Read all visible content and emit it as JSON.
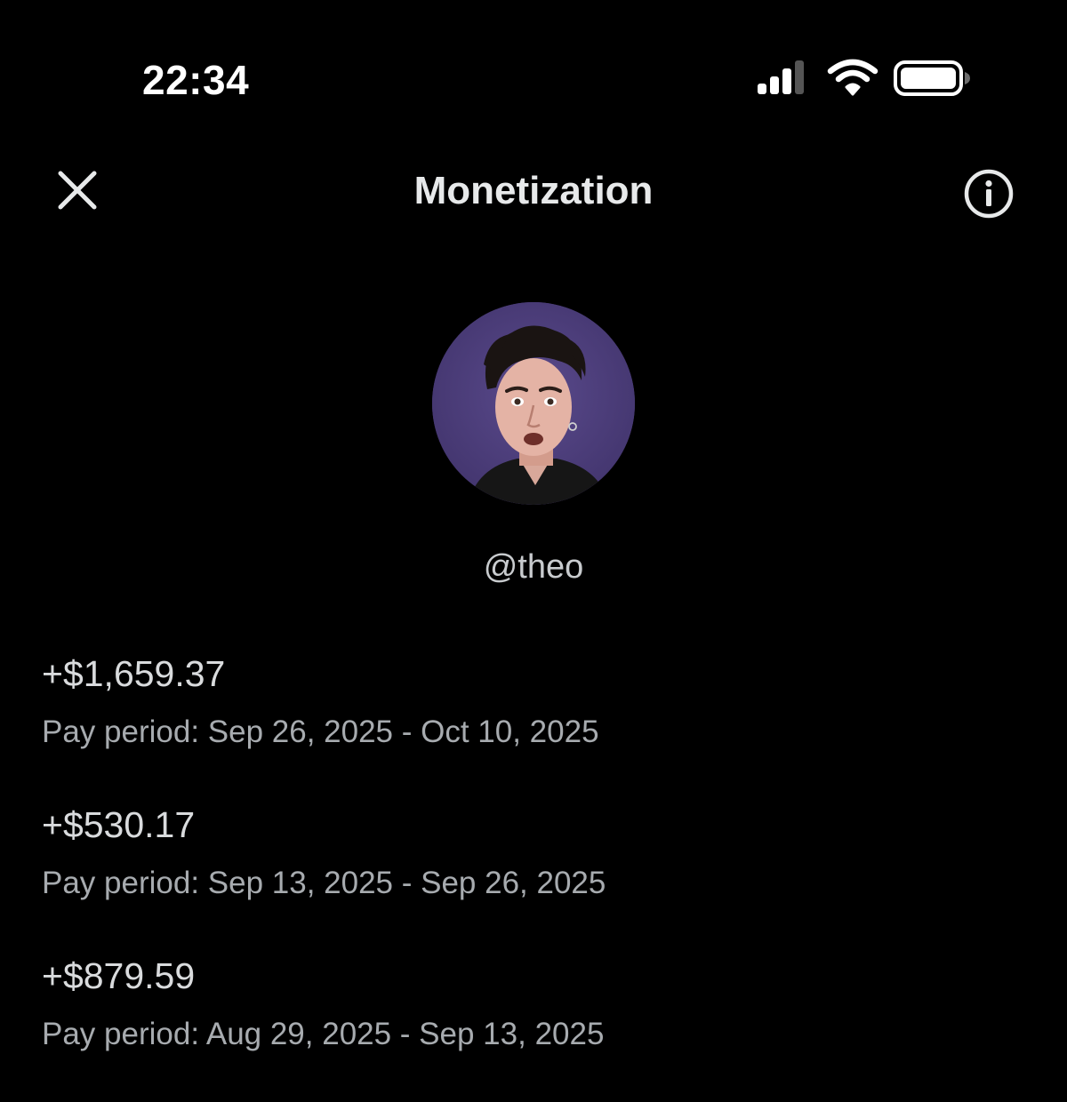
{
  "status_bar": {
    "time": "22:34",
    "signal_icon": "cellular-signal-icon",
    "wifi_icon": "wifi-icon",
    "battery_icon": "battery-icon"
  },
  "header": {
    "title": "Monetization",
    "close_icon": "close-icon",
    "info_icon": "info-icon"
  },
  "profile": {
    "handle": "@theo",
    "avatar_bg": "#4a3a78"
  },
  "payouts": [
    {
      "amount": "+$1,659.37",
      "period": "Pay period: Sep 26, 2025 - Oct 10, 2025"
    },
    {
      "amount": "+$530.17",
      "period": "Pay period: Sep 13, 2025 - Sep 26, 2025"
    },
    {
      "amount": "+$879.59",
      "period": "Pay period: Aug 29, 2025 - Sep 13, 2025"
    }
  ],
  "colors": {
    "background": "#000000",
    "text_primary": "#e7e9ea",
    "text_secondary": "#a7abaf"
  }
}
